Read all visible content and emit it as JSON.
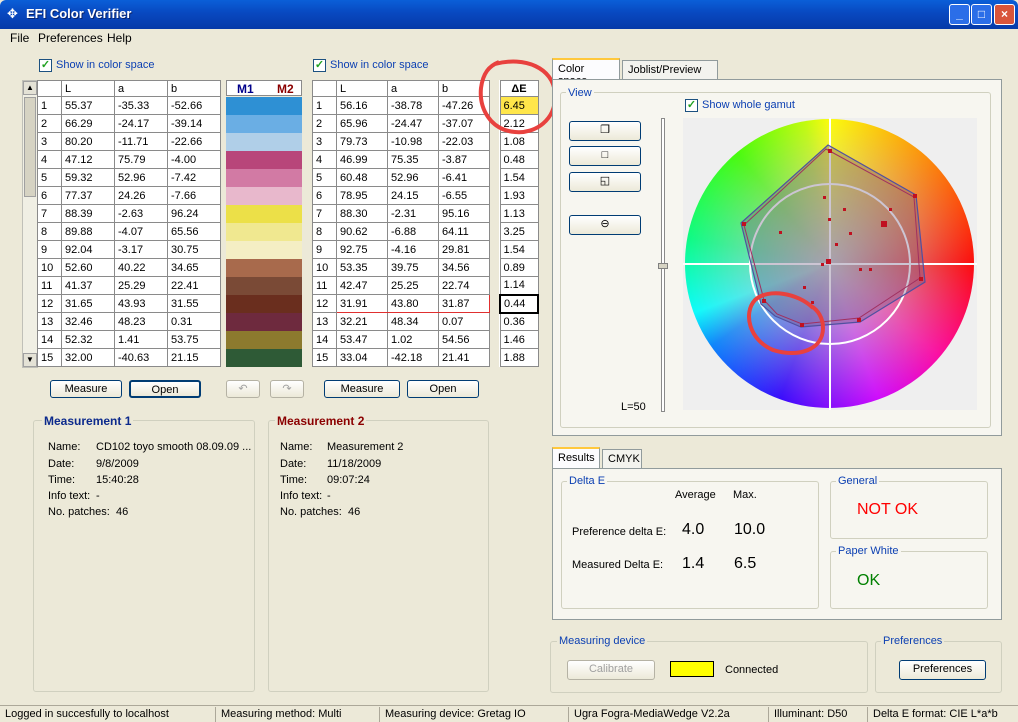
{
  "window": {
    "title": "EFI Color Verifier",
    "controls": [
      "_",
      "□",
      "×"
    ]
  },
  "menu": {
    "items": [
      "File",
      "Preferences",
      "Help"
    ]
  },
  "left_table": {
    "show_label": "Show in color space",
    "columns": [
      "L",
      "a",
      "b"
    ],
    "rows": [
      [
        "1",
        "55.37",
        "-35.33",
        "-52.66"
      ],
      [
        "2",
        "66.29",
        "-24.17",
        "-39.14"
      ],
      [
        "3",
        "80.20",
        "-11.71",
        "-22.66"
      ],
      [
        "4",
        "47.12",
        "75.79",
        "-4.00"
      ],
      [
        "5",
        "59.32",
        "52.96",
        "-7.42"
      ],
      [
        "6",
        "77.37",
        "24.26",
        "-7.66"
      ],
      [
        "7",
        "88.39",
        "-2.63",
        "96.24"
      ],
      [
        "8",
        "89.88",
        "-4.07",
        "65.56"
      ],
      [
        "9",
        "92.04",
        "-3.17",
        "30.75"
      ],
      [
        "10",
        "52.60",
        "40.22",
        "34.65"
      ],
      [
        "11",
        "41.37",
        "25.29",
        "22.41"
      ],
      [
        "12",
        "31.65",
        "43.93",
        "31.55"
      ],
      [
        "13",
        "32.46",
        "48.23",
        "0.31"
      ],
      [
        "14",
        "52.32",
        "1.41",
        "53.75"
      ],
      [
        "15",
        "32.00",
        "-40.63",
        "21.15"
      ]
    ],
    "measure_label": "Measure",
    "open_label": "Open"
  },
  "swatches": {
    "m1_label": "M1",
    "m2_label": "M2",
    "colors": [
      "#2e90d4",
      "#6aaee4",
      "#b0cfe8",
      "#b8467a",
      "#d27aa4",
      "#e8b8cc",
      "#ece048",
      "#f0e890",
      "#f4eec4",
      "#a86a4c",
      "#7a4a36",
      "#6a2e1e",
      "#6e2a3e",
      "#8c7a2e",
      "#2e5a36"
    ]
  },
  "right_table": {
    "show_label": "Show in color space",
    "columns": [
      "L",
      "a",
      "b"
    ],
    "rows": [
      [
        "1",
        "56.16",
        "-38.78",
        "-47.26"
      ],
      [
        "2",
        "65.96",
        "-24.47",
        "-37.07"
      ],
      [
        "3",
        "79.73",
        "-10.98",
        "-22.03"
      ],
      [
        "4",
        "46.99",
        "75.35",
        "-3.87"
      ],
      [
        "5",
        "60.48",
        "52.96",
        "-6.41"
      ],
      [
        "6",
        "78.95",
        "24.15",
        "-6.55"
      ],
      [
        "7",
        "88.30",
        "-2.31",
        "95.16"
      ],
      [
        "8",
        "90.62",
        "-6.88",
        "64.11"
      ],
      [
        "9",
        "92.75",
        "-4.16",
        "29.81"
      ],
      [
        "10",
        "53.35",
        "39.75",
        "34.56"
      ],
      [
        "11",
        "42.47",
        "25.25",
        "22.74"
      ],
      [
        "12",
        "31.91",
        "43.80",
        "31.87"
      ],
      [
        "13",
        "32.21",
        "48.34",
        "0.07"
      ],
      [
        "14",
        "53.47",
        "1.02",
        "54.56"
      ],
      [
        "15",
        "33.04",
        "-42.18",
        "21.41"
      ]
    ],
    "measure_label": "Measure",
    "open_label": "Open"
  },
  "delta_e": {
    "header": "ΔE",
    "values": [
      "6.45",
      "2.12",
      "1.08",
      "0.48",
      "1.54",
      "1.93",
      "1.13",
      "3.25",
      "1.54",
      "0.89",
      "1.14",
      "0.44",
      "0.36",
      "1.46",
      "1.88"
    ]
  },
  "measurement1": {
    "title": "Measurement 1",
    "name_label": "Name:",
    "name": "CD102 toyo smooth 08.09.09 ...",
    "date_label": "Date:",
    "date": "9/8/2009",
    "time_label": "Time:",
    "time": "15:40:28",
    "info_label": "Info text:",
    "info": "-",
    "patches_label": "No. patches:",
    "patches": "46"
  },
  "measurement2": {
    "title": "Measurement 2",
    "name_label": "Name:",
    "name": "Measurement 2",
    "date_label": "Date:",
    "date": "11/18/2009",
    "time_label": "Time:",
    "time": "09:07:24",
    "info_label": "Info text:",
    "info": "-",
    "patches_label": "No. patches:",
    "patches": "46"
  },
  "colorspace": {
    "tabs": [
      "Color space",
      "Joblist/Preview"
    ],
    "view_label": "View",
    "show_gamut_label": "Show whole gamut",
    "lightness_label": "L=50"
  },
  "results": {
    "tabs": [
      "Results",
      "CMYK"
    ],
    "delta_e_title": "Delta E",
    "average_label": "Average",
    "max_label": "Max.",
    "preference_label": "Preference delta E:",
    "preference_avg": "4.0",
    "preference_max": "10.0",
    "measured_label": "Measured  Delta E:",
    "measured_avg": "1.4",
    "measured_max": "6.5",
    "general_title": "General",
    "general_status": "NOT OK",
    "paper_white_title": "Paper White",
    "paper_white_status": "OK",
    "status_colors": {
      "bad": "#ff0000",
      "good": "#008000"
    }
  },
  "device": {
    "title": "Measuring device",
    "calibrate_label": "Calibrate",
    "connected_label": "Connected",
    "indicator_color": "#ffff00"
  },
  "preferences": {
    "title": "Preferences",
    "button_label": "Preferences"
  },
  "statusbar": [
    "Logged in succesfully to localhost",
    "Measuring method: Multi",
    "Measuring device: Gretag IO",
    "Ugra Fogra-MediaWedge V2.2a",
    "Illuminant: D50",
    "Delta E format: CIE L*a*b"
  ]
}
